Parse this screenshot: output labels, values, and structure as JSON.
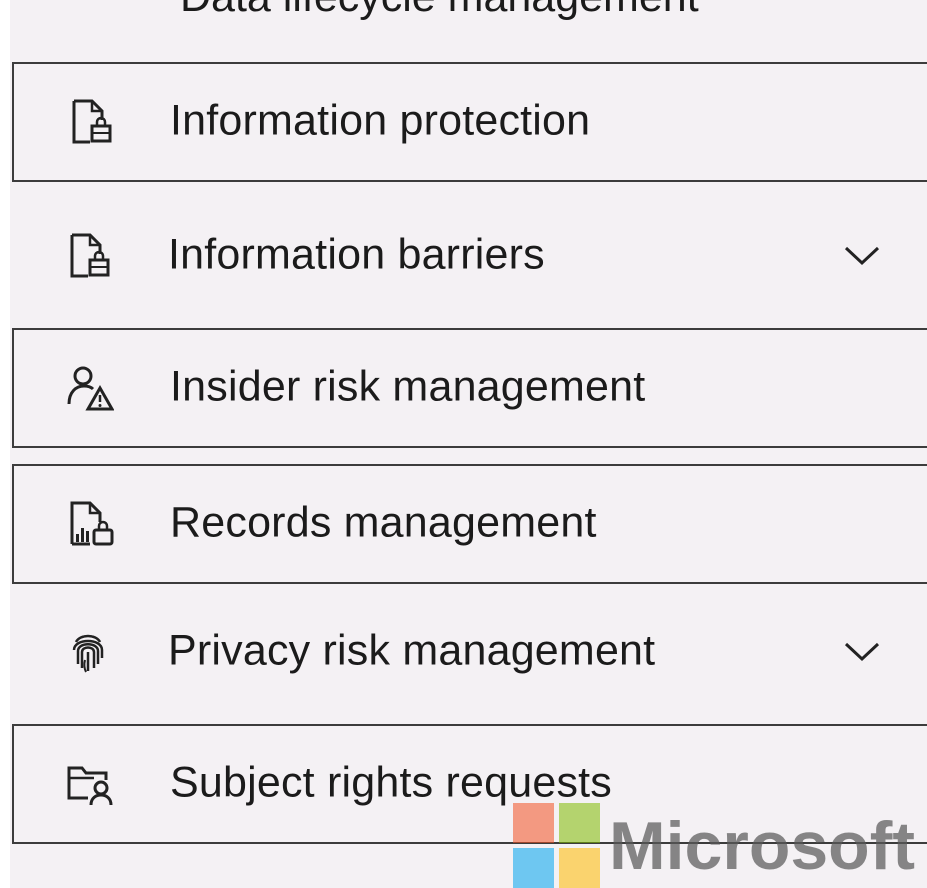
{
  "nav": {
    "cut_off_item": {
      "label": "Data lifecycle management",
      "icon": "document-lifecycle-icon"
    },
    "items": [
      {
        "label": "Information protection",
        "icon": "document-lock-icon"
      },
      {
        "label": "Information barriers",
        "icon": "document-lock-icon",
        "expandable": true
      },
      {
        "label": "Insider risk management",
        "icon": "person-warning-icon"
      },
      {
        "label": "Records management",
        "icon": "document-chart-icon"
      },
      {
        "label": "Privacy risk management",
        "icon": "fingerprint-icon",
        "expandable": true
      },
      {
        "label": "Subject rights requests",
        "icon": "folder-person-icon"
      }
    ]
  },
  "watermark": {
    "text": "Microsoft",
    "colors": {
      "red": "#f25022",
      "green": "#7fba00",
      "blue": "#00a4ef",
      "yellow": "#ffb900"
    }
  },
  "colors": {
    "background": "#f4f1f4",
    "border": "#3c3c3c",
    "text": "#1b1b1b"
  }
}
